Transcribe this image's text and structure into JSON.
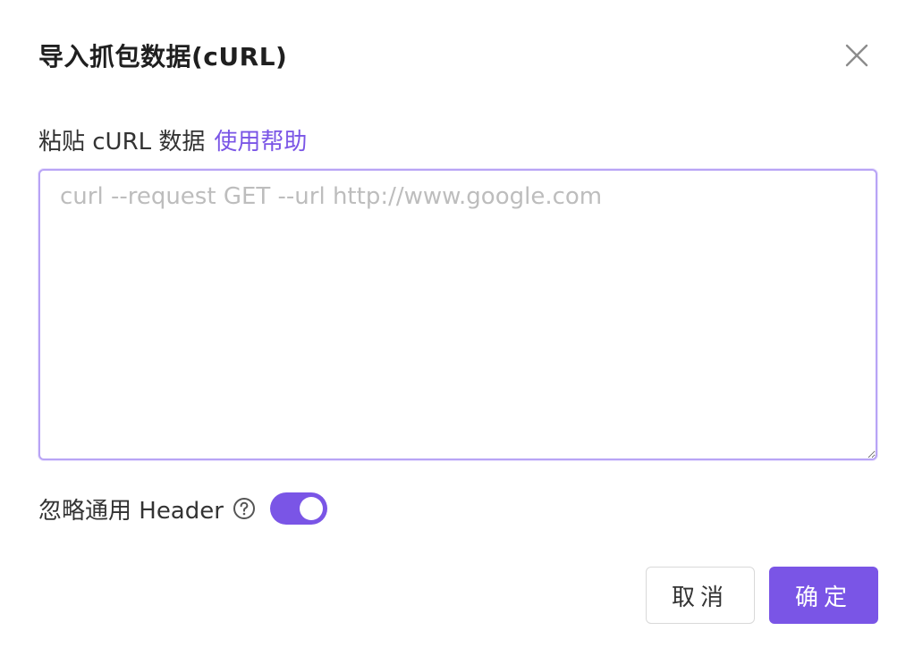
{
  "dialog": {
    "title": "导入抓包数据(cURL)"
  },
  "paste_section": {
    "label": "粘贴 cURL 数据",
    "help_link": "使用帮助"
  },
  "curl_input": {
    "value": "",
    "placeholder": "curl --request GET --url http://www.google.com"
  },
  "ignore_header": {
    "label": "忽略通用 Header",
    "enabled": true,
    "help_icon": "question-circle-icon"
  },
  "footer": {
    "cancel_label": "取消",
    "confirm_label": "确定"
  },
  "colors": {
    "accent": "#7a55e6",
    "input_border": "#b8a4f5"
  },
  "icons": {
    "close": "close-icon",
    "help": "question-circle-icon",
    "resize": "resize-handle-icon"
  }
}
